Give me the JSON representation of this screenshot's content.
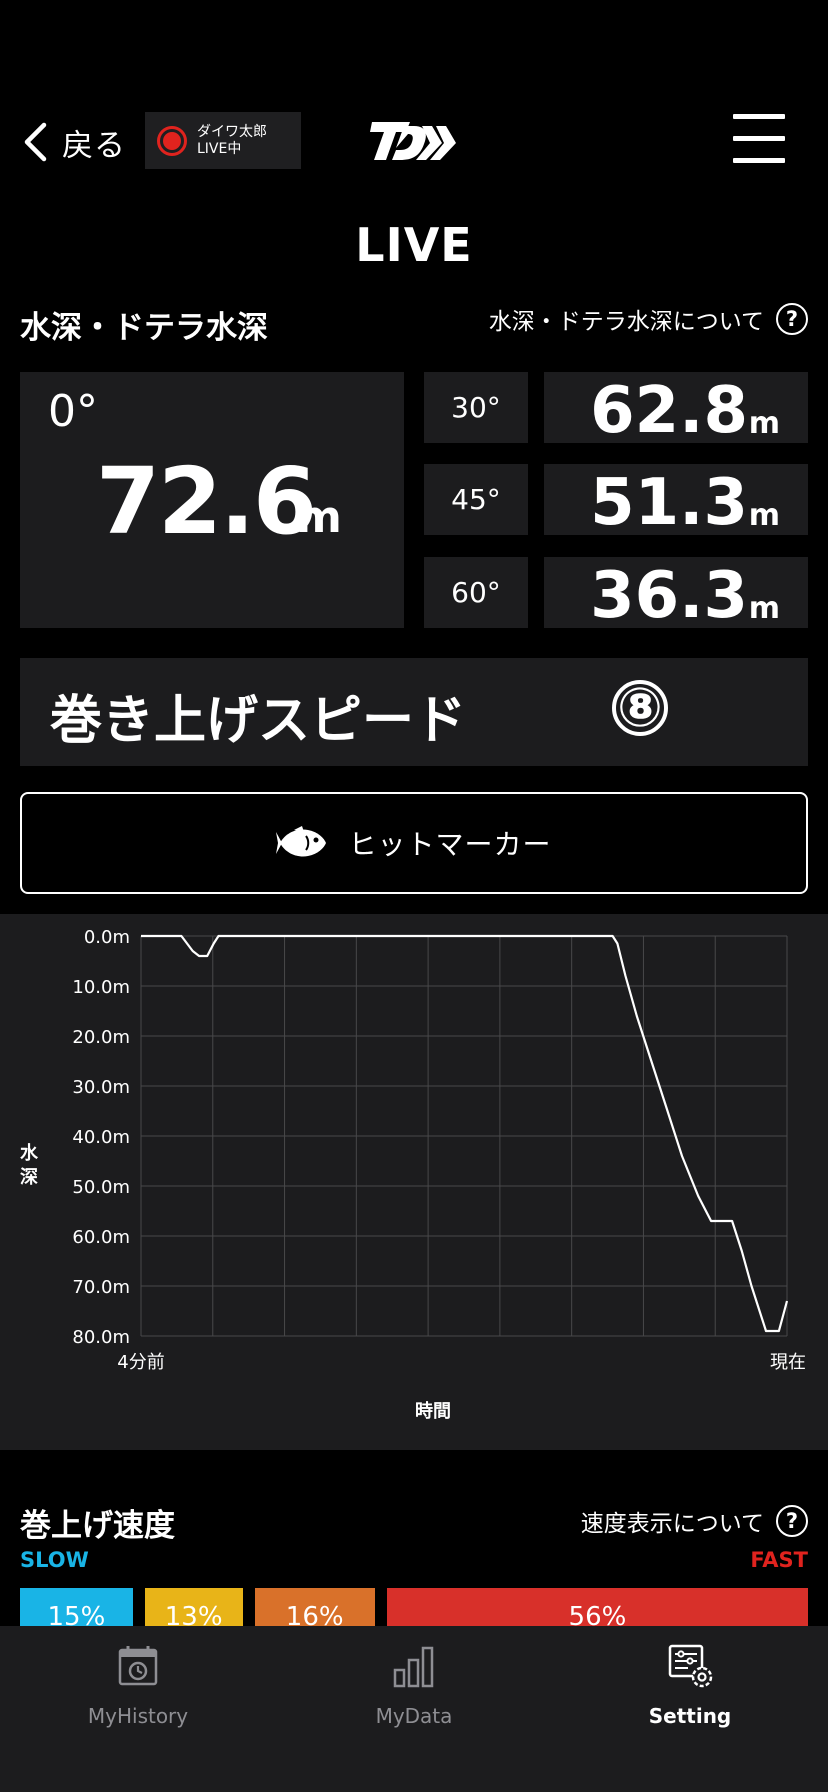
{
  "header": {
    "back_label": "戻る",
    "live_user": "ダイワ太郎",
    "live_status": "LIVE中"
  },
  "page_title": "LIVE",
  "depth": {
    "section_title": "水深・ドテラ水深",
    "info_link": "水深・ドテラ水深について",
    "main": {
      "angle": "0°",
      "value": "72.6",
      "unit": "m"
    },
    "rows": [
      {
        "angle": "30°",
        "value": "62.8",
        "unit": "m"
      },
      {
        "angle": "45°",
        "value": "51.3",
        "unit": "m"
      },
      {
        "angle": "60°",
        "value": "36.3",
        "unit": "m"
      }
    ]
  },
  "speed": {
    "label": "巻き上げスピード",
    "value": "⑧"
  },
  "hit_marker": {
    "label": "ヒットマーカー"
  },
  "chart_data": {
    "type": "line",
    "ylabel": "水深",
    "xlabel": "時間",
    "x_tick_labels": [
      "4分前",
      "現在"
    ],
    "y_tick_labels": [
      "0.0m",
      "10.0m",
      "20.0m",
      "30.0m",
      "40.0m",
      "50.0m",
      "60.0m",
      "70.0m",
      "80.0m"
    ],
    "ylim": [
      0,
      80
    ],
    "xlim": [
      -4,
      0
    ],
    "y_inverted": true,
    "grid": true,
    "x_minutes": [
      -4.0,
      -3.75,
      -3.68,
      -3.64,
      -3.59,
      -3.55,
      -3.52,
      -2.8,
      -1.6,
      -1.2,
      -1.08,
      -1.05,
      -1.0,
      -0.93,
      -0.85,
      -0.75,
      -0.65,
      -0.55,
      -0.47,
      -0.42,
      -0.34,
      -0.28,
      -0.22,
      -0.13,
      -0.05,
      0.0
    ],
    "depth_m": [
      0,
      0,
      3,
      4,
      4,
      1.5,
      0,
      0,
      0,
      0,
      0,
      1.5,
      8,
      16,
      24,
      34,
      44,
      52,
      57,
      57,
      57,
      63,
      70,
      79,
      79,
      73
    ]
  },
  "reel_speed": {
    "title": "巻上げ速度",
    "info_link": "速度表示について",
    "slow_label": "SLOW",
    "fast_label": "FAST",
    "bars": [
      {
        "label": "15%",
        "value": 15,
        "color": "#19b4e6"
      },
      {
        "label": "13%",
        "value": 13,
        "color": "#e8b418"
      },
      {
        "label": "16%",
        "value": 16,
        "color": "#d9712a"
      },
      {
        "label": "56%",
        "value": 56,
        "color": "#d8302a"
      }
    ]
  },
  "tabs": [
    {
      "label": "MyHistory",
      "icon": "history-calendar-icon",
      "active": false
    },
    {
      "label": "MyData",
      "icon": "bar-chart-icon",
      "active": false
    },
    {
      "label": "Setting",
      "icon": "settings-icon",
      "active": true
    }
  ],
  "colors": {
    "accent_slow": "#19b4e6",
    "accent_fast": "#e0231e",
    "panel": "#1c1c1e",
    "tab_inactive": "#8e8e93"
  }
}
